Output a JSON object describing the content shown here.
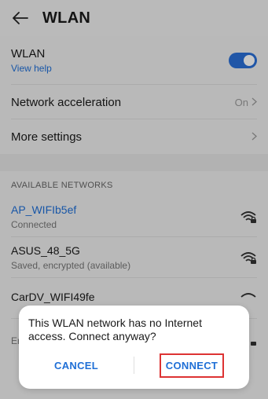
{
  "header": {
    "title": "WLAN"
  },
  "wlan": {
    "label": "WLAN",
    "help": "View help",
    "enabled": true
  },
  "settings": [
    {
      "label": "Network acceleration",
      "value": "On"
    },
    {
      "label": "More settings",
      "value": ""
    }
  ],
  "networks": {
    "section_title": "AVAILABLE NETWORKS",
    "items": [
      {
        "name": "AP_WIFIb5ef",
        "status": "Connected"
      },
      {
        "name": "ASUS_48_5G",
        "status": "Saved, encrypted (available)"
      },
      {
        "name": "CarDV_WIFI49fe",
        "status": ""
      },
      {
        "name": "",
        "status": "Encrypted"
      }
    ]
  },
  "dialog": {
    "message": "This WLAN network has no Internet access. Connect anyway?",
    "cancel": "CANCEL",
    "connect": "CONNECT"
  },
  "colors": {
    "accent": "#1f6fd6",
    "highlight_box": "#dd3333"
  }
}
